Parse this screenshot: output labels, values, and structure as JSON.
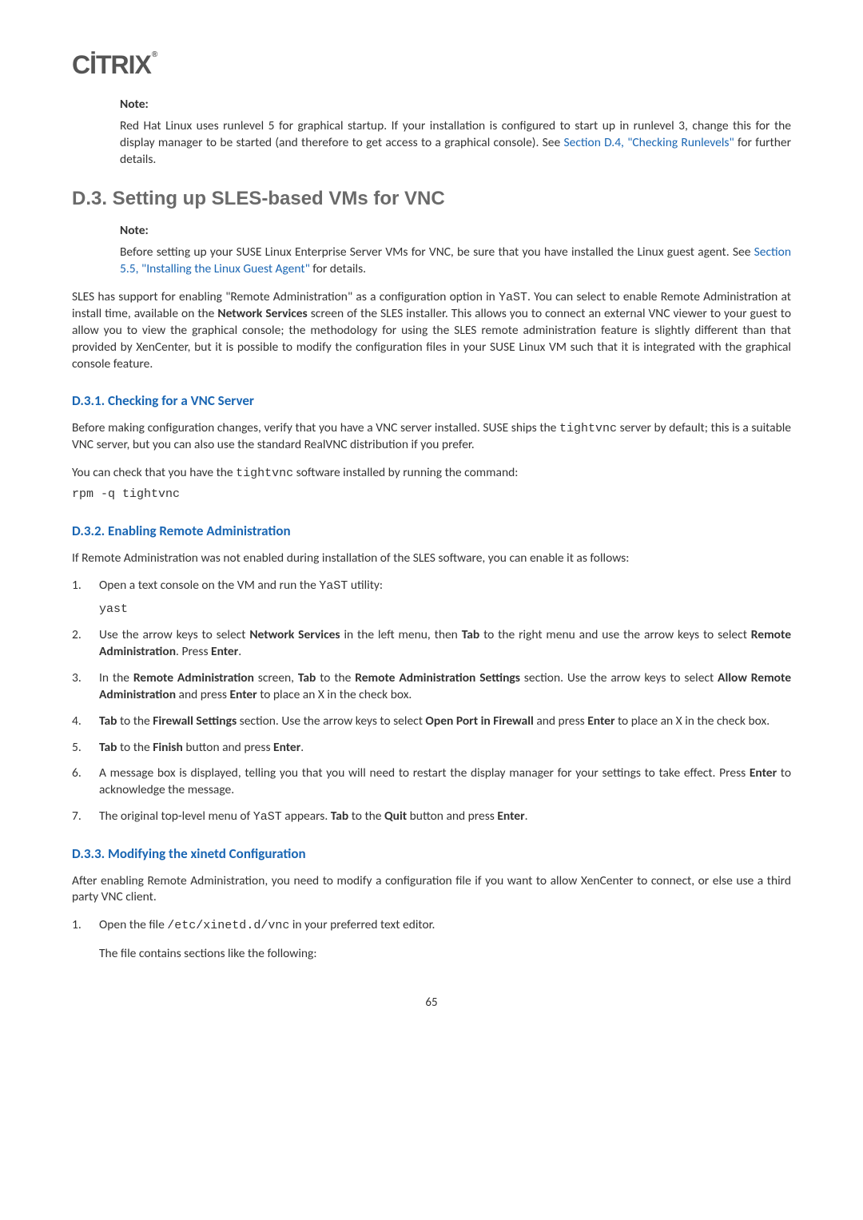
{
  "logo": {
    "text": "CİTRIX"
  },
  "note1": {
    "label": "Note:",
    "text_a": "Red Hat Linux uses runlevel 5 for graphical startup. If your installation is configured to start up in runlevel 3, change this for the display manager to be started (and therefore to get access to a graphical console). See ",
    "link": "Section D.4, \"Checking Runlevels\"",
    "text_b": " for further details."
  },
  "heading_d3": "D.3. Setting up SLES-based VMs for VNC",
  "note2": {
    "label": "Note:",
    "text_a": "Before setting up your SUSE Linux Enterprise Server VMs for VNC, be sure that you have installed the Linux guest agent. See ",
    "link": "Section 5.5, \"Installing the Linux Guest Agent\"",
    "text_b": " for details."
  },
  "para_sles_1a": "SLES has support for enabling \"Remote Administration\" as a configuration option in ",
  "code_yast1": "YaST",
  "para_sles_1b": ". You can select to enable Remote Administration at install time, available on the ",
  "bold_network_services": "Network Services",
  "para_sles_1c": " screen of the SLES installer. This allows you to connect an external VNC viewer to your guest to allow you to view the graphical console; the methodology for using the SLES remote administration feature is slightly different than that provided by XenCenter, but it is possible to modify the configuration files in your SUSE Linux VM such that it is integrated with the graphical console feature.",
  "heading_d31": "D.3.1. Checking for a VNC Server",
  "para_d31_a1": "Before making configuration changes, verify that you have a VNC server installed. SUSE ships the ",
  "code_tightvnc1": "tightvnc",
  "para_d31_a2": " server by default; this is a suitable VNC server, but you can also use the standard RealVNC distribution if you prefer.",
  "para_d31_b1": "You can check that you have the ",
  "code_tightvnc2": "tightvnc",
  "para_d31_b2": " software installed by running the command:",
  "code_block1": "rpm -q tightvnc",
  "heading_d32": "D.3.2. Enabling Remote Administration",
  "para_d32": "If Remote Administration was not enabled during installation of the SLES software, you can enable it as follows:",
  "steps_d32": [
    {
      "pre": "Open a text console on the VM and run the ",
      "code1": "YaST",
      "post1": " utility:",
      "block": "yast"
    },
    {
      "text": "Use the arrow keys to select <b>Network Services</b> in the left menu, then <b>Tab</b> to the right menu and use the arrow keys to select <b>Remote Administration</b>. Press <b>Enter</b>."
    },
    {
      "text": "In the <b>Remote Administration</b> screen, <b>Tab</b> to the <b>Remote Administration Settings</b> section. Use the arrow keys to select <b>Allow Remote Administration</b> and press <b>Enter</b> to place an X in the check box."
    },
    {
      "text": "<b>Tab</b> to the <b>Firewall Settings</b> section. Use the arrow keys to select <b>Open Port in Firewall</b> and press <b>Enter</b> to place an X in the check box."
    },
    {
      "text": "<b>Tab</b> to the <b>Finish</b> button and press <b>Enter</b>."
    },
    {
      "text": "A message box is displayed, telling you that you will need to restart the display manager for your settings to take effect. Press <b>Enter</b> to acknowledge the message."
    },
    {
      "pre2": "The original top-level menu of ",
      "code1": "YaST",
      "post2": " appears. <b>Tab</b> to the <b>Quit</b> button and press <b>Enter</b>."
    }
  ],
  "heading_d33": "D.3.3. Modifying the xinetd Configuration",
  "para_d33": "After enabling Remote Administration, you need to modify a configuration file if you want to allow XenCenter to connect, or else use a third party VNC client.",
  "step_d33_pre": "Open the file ",
  "code_path": "/etc/xinetd.d/vnc",
  "step_d33_post": " in your preferred text editor.",
  "step_d33_line2": "The file contains sections like the following:",
  "page_number": "65"
}
